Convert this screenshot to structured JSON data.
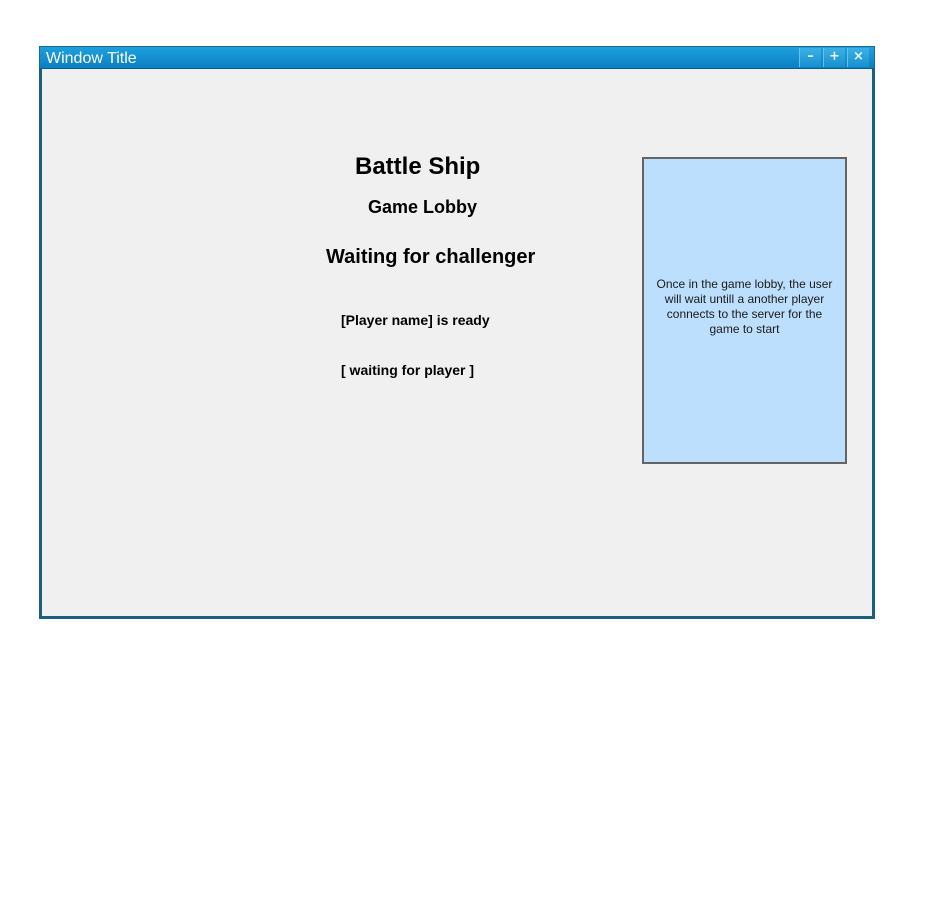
{
  "window": {
    "title": "Window Title",
    "controls": {
      "minimize": "–",
      "maximize": "+",
      "close": "×"
    }
  },
  "lobby": {
    "game_title": "Battle Ship",
    "subtitle": "Game Lobby",
    "status": "Waiting for challenger",
    "player_ready": "[Player name] is ready",
    "waiting_player": "[ waiting for player ]"
  },
  "note": {
    "text": "Once in the game lobby, the user will wait untill a another player connects to the server for the game to start"
  },
  "colors": {
    "titlebar": "#0b7fc1",
    "window_border": "#1b5f80",
    "window_bg": "#f0f0f0",
    "note_bg": "#bcdffd",
    "note_border": "#646464"
  },
  "icons": {
    "minimize": "minimize-icon",
    "maximize": "maximize-icon",
    "close": "close-icon"
  }
}
